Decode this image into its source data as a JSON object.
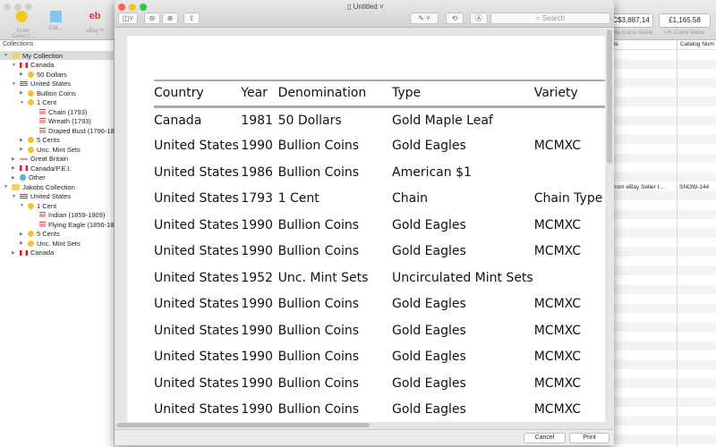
{
  "app": {
    "toolbar": [
      {
        "label": "Enter Coin(s)..."
      },
      {
        "label": "Edit..."
      },
      {
        "label": "eBay™"
      }
    ],
    "collections_header": "Collections",
    "tree": [
      {
        "label": "My Collection",
        "level": 0,
        "icon": "folder",
        "open": true,
        "selected": true
      },
      {
        "label": "Canada",
        "level": 1,
        "icon": "flag-ca",
        "open": true
      },
      {
        "label": "50 Dollars",
        "level": 2,
        "icon": "coin",
        "open": false
      },
      {
        "label": "United States",
        "level": 1,
        "icon": "flag-us",
        "open": true
      },
      {
        "label": "Bullion Coins",
        "level": 2,
        "icon": "coin",
        "open": false
      },
      {
        "label": "1 Cent",
        "level": 2,
        "icon": "coin",
        "open": true
      },
      {
        "label": "Chain (1793)",
        "level": 3,
        "icon": "list"
      },
      {
        "label": "Wreath (1793)",
        "level": 3,
        "icon": "list"
      },
      {
        "label": "Draped Bust (1796-180",
        "level": 3,
        "icon": "list"
      },
      {
        "label": "5 Cents",
        "level": 2,
        "icon": "coin",
        "open": false
      },
      {
        "label": "Unc. Mint Sets",
        "level": 2,
        "icon": "coin",
        "open": false
      },
      {
        "label": "Great Britain",
        "level": 1,
        "icon": "flag-gb",
        "open": false
      },
      {
        "label": "Canada/P.E.I.",
        "level": 1,
        "icon": "flag-ca",
        "open": false
      },
      {
        "label": "Other",
        "level": 1,
        "icon": "globe",
        "open": false
      },
      {
        "label": "Jakobs Collection",
        "level": 0,
        "icon": "folder",
        "open": true
      },
      {
        "label": "United States",
        "level": 1,
        "icon": "flag-us",
        "open": true
      },
      {
        "label": "1 Cent",
        "level": 2,
        "icon": "coin",
        "open": true
      },
      {
        "label": "Indian (1859-1909)",
        "level": 3,
        "icon": "list"
      },
      {
        "label": "Flying Eagle (1856-185",
        "level": 3,
        "icon": "list"
      },
      {
        "label": "5 Cents",
        "level": 2,
        "icon": "coin",
        "open": false
      },
      {
        "label": "Unc. Mint Sets",
        "level": 2,
        "icon": "coin",
        "open": false
      },
      {
        "label": "Canada",
        "level": 1,
        "icon": "flag-ca",
        "open": false
      }
    ],
    "values": [
      {
        "value": "C$3,887.14",
        "label": "ada Coins Value"
      },
      {
        "value": "£1,165.58",
        "label": "UK Coins Value"
      }
    ],
    "columns": [
      "nts",
      "Catalog Num"
    ],
    "row": {
      "comments": "t from eBay Seller I...",
      "catalog": "SNOW-144"
    }
  },
  "preview": {
    "title": "Untitled",
    "search_placeholder": "Search",
    "cancel": "Cancel",
    "print": "Print",
    "headers": [
      "Country",
      "Year",
      "Denomination",
      "Type",
      "Variety"
    ],
    "rows": [
      [
        "Canada",
        "1981",
        "50 Dollars",
        "Gold Maple Leaf",
        ""
      ],
      [
        "United States",
        "1990",
        "Bullion Coins",
        "Gold Eagles",
        "MCMXC"
      ],
      [
        "United States",
        "1986",
        "Bullion Coins",
        "American $1",
        ""
      ],
      [
        "United States",
        "1793",
        "1 Cent",
        "Chain",
        "Chain Type"
      ],
      [
        "United States",
        "1990",
        "Bullion Coins",
        "Gold Eagles",
        "MCMXC"
      ],
      [
        "United States",
        "1990",
        "Bullion Coins",
        "Gold Eagles",
        "MCMXC"
      ],
      [
        "United States",
        "1952",
        "Unc. Mint Sets",
        "Uncirculated Mint Sets",
        ""
      ],
      [
        "United States",
        "1990",
        "Bullion Coins",
        "Gold Eagles",
        "MCMXC"
      ],
      [
        "United States",
        "1990",
        "Bullion Coins",
        "Gold Eagles",
        "MCMXC"
      ],
      [
        "United States",
        "1990",
        "Bullion Coins",
        "Gold Eagles",
        "MCMXC"
      ],
      [
        "United States",
        "1990",
        "Bullion Coins",
        "Gold Eagles",
        "MCMXC"
      ],
      [
        "United States",
        "1990",
        "Bullion Coins",
        "Gold Eagles",
        "MCMXC"
      ]
    ]
  }
}
